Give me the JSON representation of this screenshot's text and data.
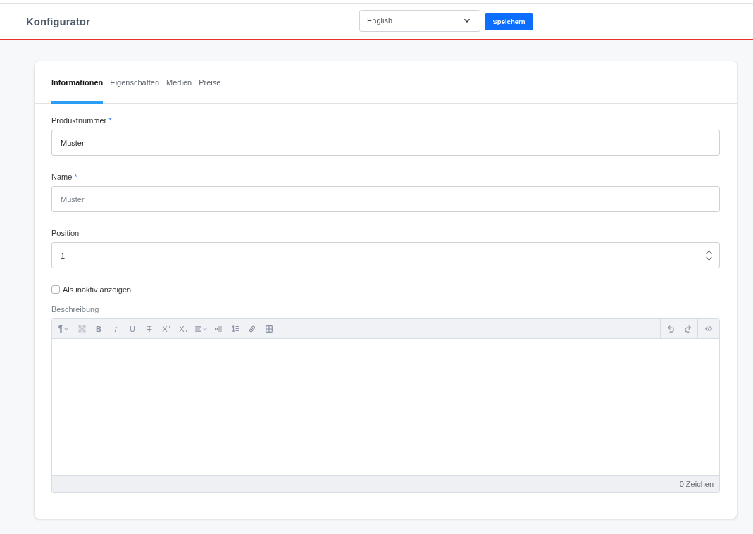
{
  "header": {
    "title": "Konfigurator",
    "language_select": {
      "value": "English"
    },
    "save_button": "Speichern"
  },
  "tabs": [
    {
      "label": "Informationen",
      "selected": true
    },
    {
      "label": "Eigenschaften",
      "selected": false
    },
    {
      "label": "Medien",
      "selected": false
    },
    {
      "label": "Preise",
      "selected": false
    }
  ],
  "fields": [
    {
      "kind": "text",
      "label": "Produktnummer",
      "required_mark": "*",
      "value": "Muster"
    },
    {
      "kind": "text",
      "label": "Name",
      "required_mark": "*",
      "placeholder": "Muster"
    },
    {
      "kind": "number",
      "label": "Position",
      "value": "1"
    }
  ],
  "checkbox": {
    "label": "Als inaktiv anzeigen",
    "checked": false
  },
  "editor": {
    "label": "Beschreibung",
    "toolbar": {
      "format": [
        {
          "kind": "paragraph",
          "glyph": "¶"
        },
        {
          "kind": "color"
        },
        {
          "kind": "bold",
          "glyph": "B"
        },
        {
          "kind": "italic",
          "glyph": "I"
        },
        {
          "kind": "underline",
          "glyph": "U"
        },
        {
          "kind": "strike",
          "glyph": "T"
        },
        {
          "kind": "superscript",
          "glyph": "X"
        },
        {
          "kind": "subscript",
          "glyph": "X"
        },
        {
          "kind": "align"
        },
        {
          "kind": "bullet_list"
        },
        {
          "kind": "numbered_list"
        },
        {
          "kind": "link"
        },
        {
          "kind": "table"
        }
      ],
      "history": [
        {
          "kind": "undo"
        },
        {
          "kind": "redo"
        }
      ],
      "source": [
        {
          "kind": "source"
        }
      ]
    },
    "char_count": "0 Zeichen"
  }
}
